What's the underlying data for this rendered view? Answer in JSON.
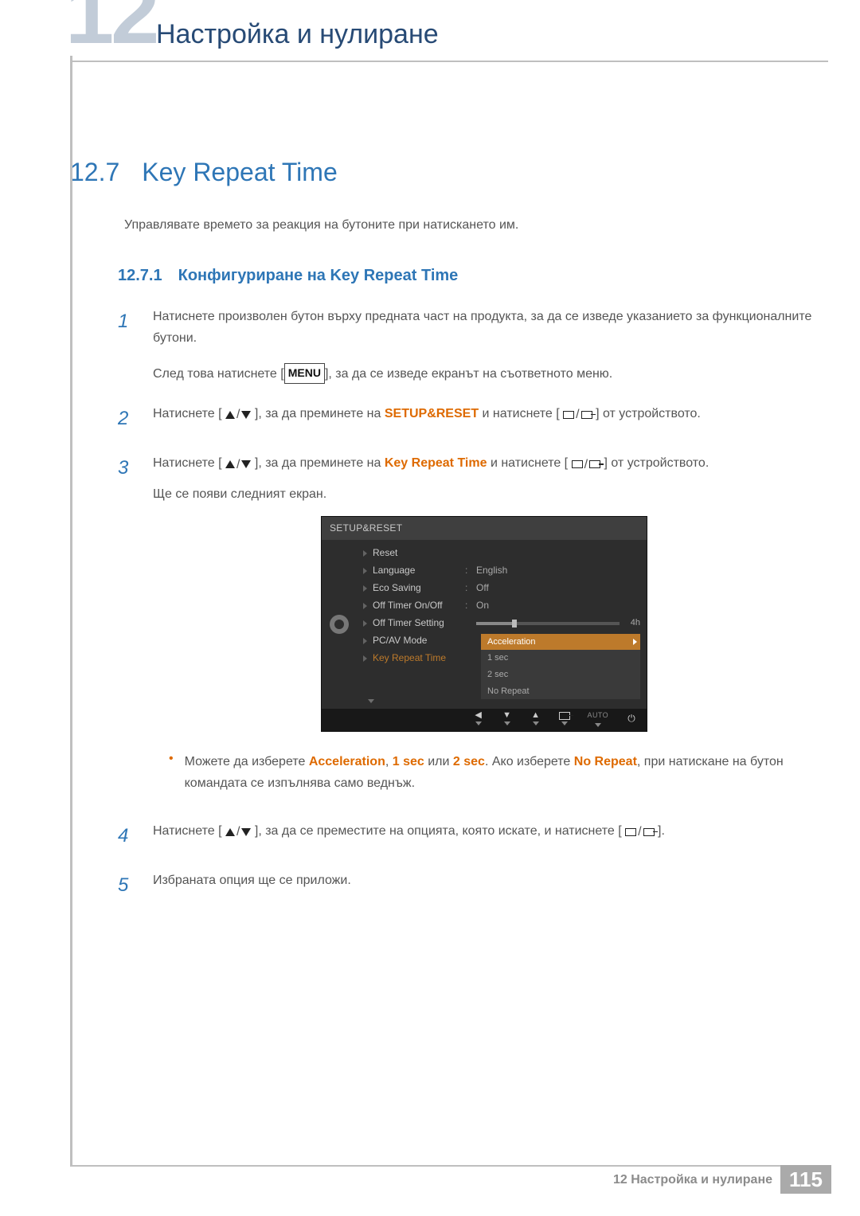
{
  "chapter": {
    "num_bg": "12",
    "title": "Настройка и нулиране"
  },
  "section": {
    "num": "12.7",
    "title": "Key Repeat Time"
  },
  "intro": "Управлявате времето за реакция на бутоните при натискането им.",
  "subsection": {
    "num": "12.7.1",
    "title": "Конфигуриране на Key Repeat Time"
  },
  "steps": {
    "s1": {
      "num": "1",
      "line1": "Натиснете произволен бутон върху предната част на продукта, за да се изведе указанието за функционалните бутони.",
      "line2_a": "След това натиснете [",
      "menu": "MENU",
      "line2_b": "], за да се изведе екранът на съответното меню."
    },
    "s2": {
      "num": "2",
      "a": "Натиснете [",
      "b": "], за да преминете на ",
      "setup": "SETUP&RESET",
      "c": " и натиснете [",
      "d": "] от устройството."
    },
    "s3": {
      "num": "3",
      "a": "Натиснете [",
      "b": "], за да преминете на ",
      "krt": "Key Repeat Time",
      "c": " и натиснете [",
      "d": "] от устройството.",
      "line2": "Ще се появи следният екран."
    },
    "s4": {
      "num": "4",
      "a": "Натиснете [",
      "b": "], за да се преместите на опцията, която искате, и натиснете [",
      "c": "]."
    },
    "s5": {
      "num": "5",
      "text": "Избраната опция ще се приложи."
    }
  },
  "bullet": {
    "a": "Можете да изберете ",
    "accel": "Acceleration",
    "comma1": ", ",
    "one": "1 sec",
    "or": " или ",
    "two": "2 sec",
    "after": ". Ако изберете ",
    "nr": "No Repeat",
    "tail": ", при натискане на бутон командата се изпълнява само веднъж."
  },
  "osd": {
    "title": "SETUP&RESET",
    "rows": {
      "reset": "Reset",
      "language": "Language",
      "language_v": "English",
      "eco": "Eco Saving",
      "eco_v": "Off",
      "otoo": "Off Timer On/Off",
      "otoo_v": "On",
      "ots": "Off Timer Setting",
      "ots_v": "4h",
      "pcav": "PC/AV Mode",
      "krt": "Key Repeat Time"
    },
    "popup": {
      "accel": "Acceleration",
      "one": "1 sec",
      "two": "2 sec",
      "nr": "No Repeat"
    },
    "footer_auto": "AUTO"
  },
  "footer": {
    "text": "12 Настройка и нулиране",
    "page": "115"
  }
}
